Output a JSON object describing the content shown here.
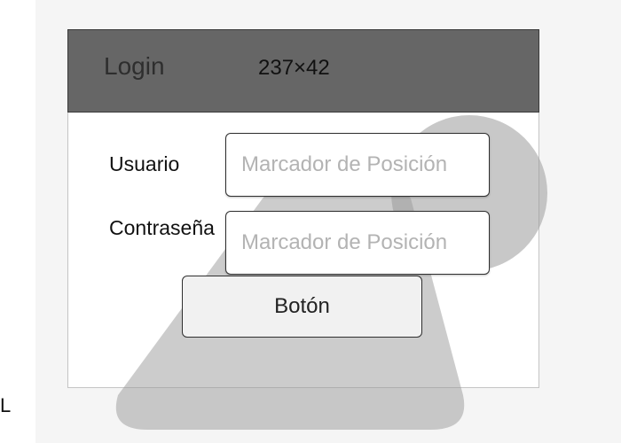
{
  "window": {
    "title": "Login",
    "size_readout": "237×42"
  },
  "form": {
    "username_label": "Usuario",
    "username_placeholder": "Marcador de Posición",
    "password_label": "Contraseña",
    "password_placeholder": "Marcador de Posición",
    "button_label": "Botón"
  },
  "edge_glyph": "L",
  "colors": {
    "header_fill": "#666666",
    "overlay_fill": "#9a9a9a",
    "panel_border": "#c4c4c4"
  }
}
